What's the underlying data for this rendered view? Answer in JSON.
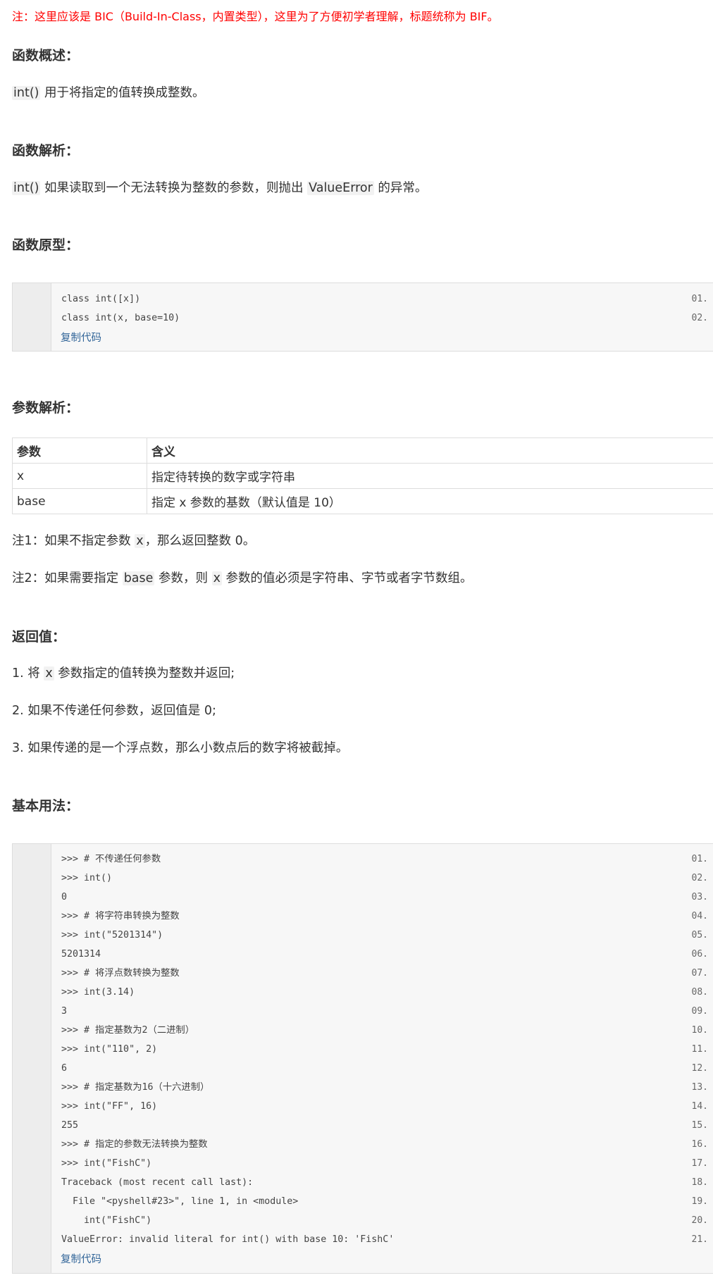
{
  "note_top": "注：这里应该是 BIC（Build-In-Class，内置类型），这里为了方便初学者理解，标题统称为 BIF。",
  "sections": {
    "overview": {
      "heading": "函数概述：",
      "code_term": "int()",
      "text": " 用于将指定的值转换成整数。"
    },
    "analysis": {
      "heading": "函数解析：",
      "code_term": "int()",
      "text_a": " 如果读取到一个无法转换为整数的参数，则抛出 ",
      "code_term2": "ValueError",
      "text_b": " 的异常。"
    },
    "prototype": {
      "heading": "函数原型：",
      "lines": [
        {
          "num": "01.",
          "code": "class int([x])"
        },
        {
          "num": "02.",
          "code": "class int(x, base=10)"
        }
      ],
      "copy_label": "复制代码"
    },
    "params": {
      "heading": "参数解析：",
      "header": [
        "参数",
        "含义"
      ],
      "rows": [
        [
          "x",
          "指定待转换的数字或字符串"
        ],
        [
          "base",
          "指定 x 参数的基数（默认值是 10）"
        ]
      ],
      "note1_a": "注1：如果不指定参数 ",
      "note1_code": "x",
      "note1_b": "，那么返回整数 0。",
      "note2_a": "注2：如果需要指定 ",
      "note2_code": "base",
      "note2_b": " 参数，则 ",
      "note2_code2": "x",
      "note2_c": " 参数的值必须是字符串、字节或者字节数组。"
    },
    "returns": {
      "heading": "返回值：",
      "item1_a": "1. 将 ",
      "item1_code": "x",
      "item1_b": " 参数指定的值转换为整数并返回;",
      "item2": "2. 如果不传递任何参数，返回值是 0;",
      "item3": "3. 如果传递的是一个浮点数，那么小数点后的数字将被截掉。"
    },
    "usage": {
      "heading": "基本用法：",
      "lines": [
        {
          "num": "01.",
          "code": ">>> # 不传递任何参数"
        },
        {
          "num": "02.",
          "code": ">>> int()"
        },
        {
          "num": "03.",
          "code": "0"
        },
        {
          "num": "04.",
          "code": ">>> # 将字符串转换为整数"
        },
        {
          "num": "05.",
          "code": ">>> int(\"5201314\")"
        },
        {
          "num": "06.",
          "code": "5201314"
        },
        {
          "num": "07.",
          "code": ">>> # 将浮点数转换为整数"
        },
        {
          "num": "08.",
          "code": ">>> int(3.14)"
        },
        {
          "num": "09.",
          "code": "3"
        },
        {
          "num": "10.",
          "code": ">>> # 指定基数为2（二进制）"
        },
        {
          "num": "11.",
          "code": ">>> int(\"110\", 2)"
        },
        {
          "num": "12.",
          "code": "6"
        },
        {
          "num": "13.",
          "code": ">>> # 指定基数为16（十六进制）"
        },
        {
          "num": "14.",
          "code": ">>> int(\"FF\", 16)"
        },
        {
          "num": "15.",
          "code": "255"
        },
        {
          "num": "16.",
          "code": ">>> # 指定的参数无法转换为整数"
        },
        {
          "num": "17.",
          "code": ">>> int(\"FishC\")"
        },
        {
          "num": "18.",
          "code": "Traceback (most recent call last):"
        },
        {
          "num": "19.",
          "code": "  File \"<pyshell#23>\", line 1, in <module>"
        },
        {
          "num": "20.",
          "code": "    int(\"FishC\")"
        },
        {
          "num": "21.",
          "code": "ValueError: invalid literal for int() with base 10: 'FishC'"
        }
      ],
      "copy_label": "复制代码"
    }
  }
}
